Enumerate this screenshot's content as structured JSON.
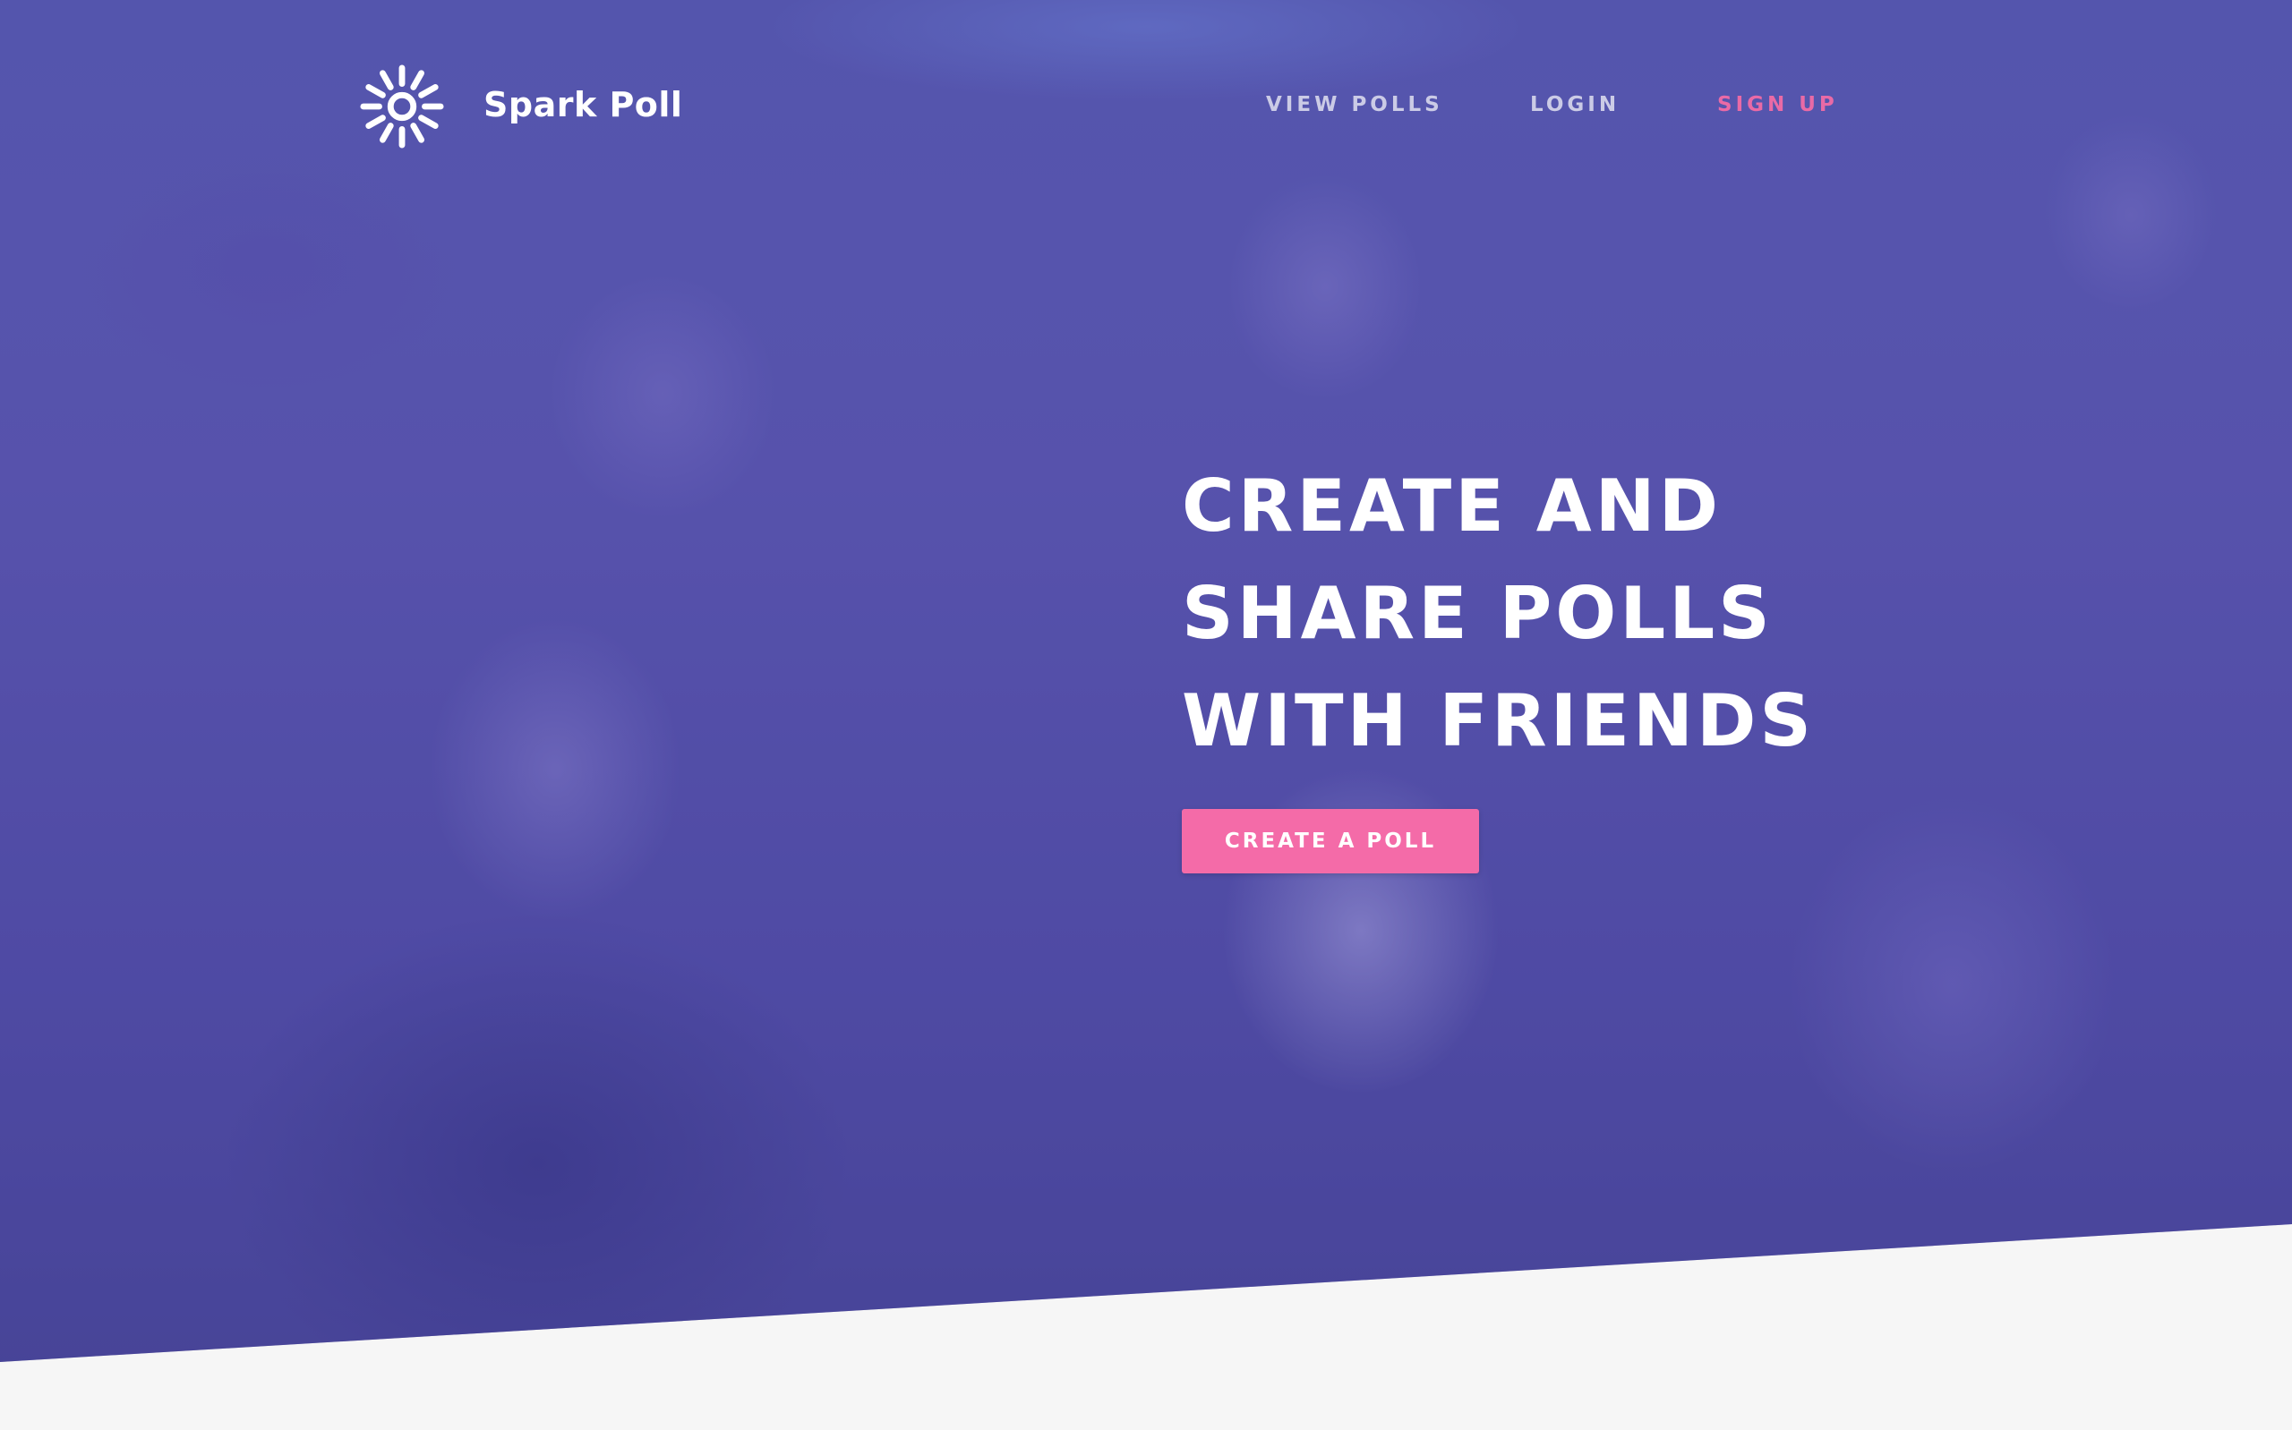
{
  "nav": {
    "brand": "Spark Poll",
    "logo_icon": "sun-icon",
    "links": [
      {
        "label": "VIEW POLLS"
      },
      {
        "label": "LOGIN"
      },
      {
        "label": "SIGN UP"
      }
    ]
  },
  "hero": {
    "headline": [
      "CREATE AND",
      "SHARE POLLS",
      "WITH FRIENDS"
    ],
    "cta_label": "CREATE A POLL"
  },
  "colors": {
    "overlay": "#5a5aaf",
    "accent": "#f46ba8",
    "signup_link": "#e96aa6",
    "page_bg": "#f6f6f6"
  }
}
